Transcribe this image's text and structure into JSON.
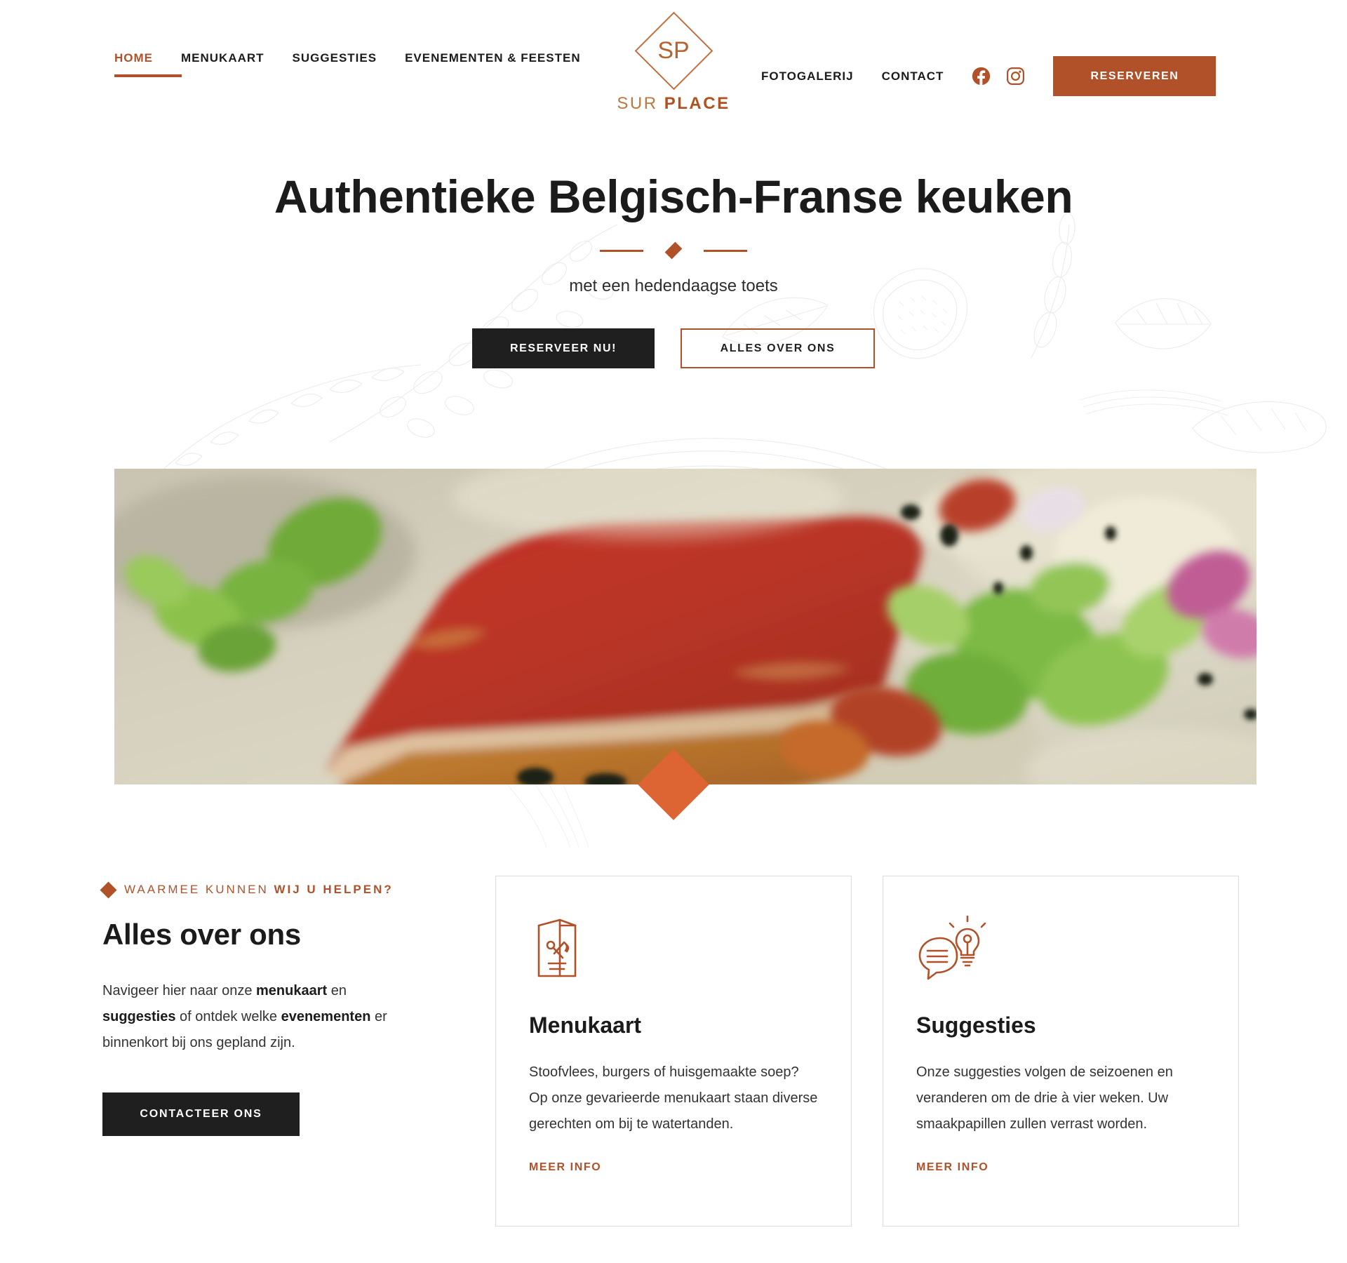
{
  "brand": {
    "monogram": "SP",
    "name_light": "SUR ",
    "name_bold": "PLACE",
    "accent": "#b0512a",
    "accent_bright": "#dd6433",
    "dark": "#1f1f1f"
  },
  "nav": {
    "items": [
      {
        "label": "HOME",
        "active": true
      },
      {
        "label": "MENUKAART",
        "active": false
      },
      {
        "label": "SUGGESTIES",
        "active": false
      },
      {
        "label": "EVENEMENTEN & FEESTEN",
        "active": false
      }
    ],
    "right_items": [
      {
        "label": "FOTOGALERIJ"
      },
      {
        "label": "CONTACT"
      }
    ],
    "social": [
      {
        "name": "facebook-icon"
      },
      {
        "name": "instagram-icon"
      }
    ],
    "cta_label": "RESERVEREN"
  },
  "hero": {
    "title": "Authentieke Belgisch-Franse keuken",
    "subtitle": "met een hedendaagse toets",
    "primary_button": "RESERVEER NU!",
    "secondary_button": "ALLES OVER ONS"
  },
  "about": {
    "eyebrow_regular": "WAARMEE KUNNEN ",
    "eyebrow_bold": "WIJ U HELPEN?",
    "heading": "Alles over ons",
    "paragraph_1": "Navigeer hier naar onze ",
    "paragraph_b1": "menukaart",
    "paragraph_2": " en ",
    "paragraph_b2": "suggesties",
    "paragraph_3": " of ontdek welke ",
    "paragraph_b3": "evenementen",
    "paragraph_4": " er binnenkort bij ons gepland zijn.",
    "button_label": "CONTACTEER ONS"
  },
  "cards": [
    {
      "icon": "menu-card-icon",
      "title": "Menukaart",
      "text": "Stoofvlees, burgers of huisgemaakte soep? Op onze gevarieerde menukaart staan diverse gerechten om bij te watertanden.",
      "link": "MEER INFO"
    },
    {
      "icon": "speech-bubble-lightbulb-icon",
      "title": "Suggesties",
      "text": "Onze suggesties volgen de seizoenen en veranderen om de drie à vier weken. Uw smaakpapillen zullen verrast worden.",
      "link": "MEER INFO"
    }
  ]
}
